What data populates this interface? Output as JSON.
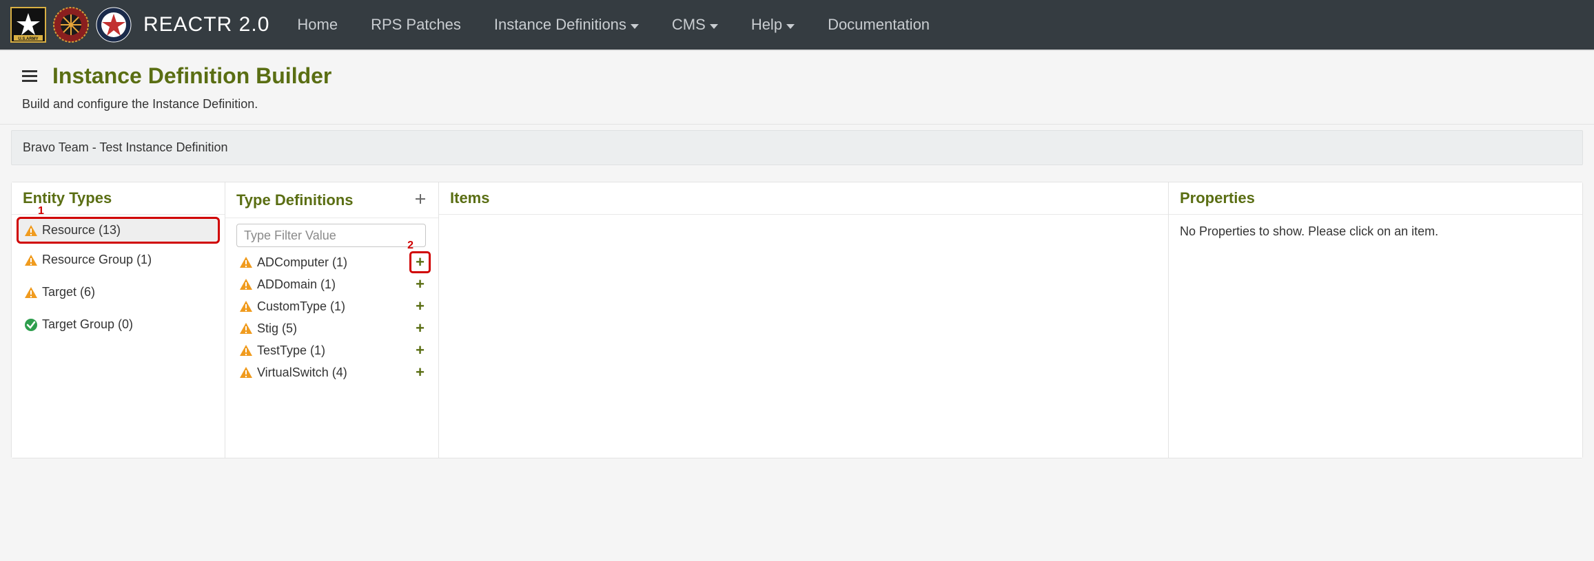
{
  "brand": "REACTR 2.0",
  "nav": {
    "home": "Home",
    "rps": "RPS Patches",
    "instdef": "Instance Definitions",
    "cms": "CMS",
    "help": "Help",
    "docs": "Documentation"
  },
  "page": {
    "title": "Instance Definition Builder",
    "subtitle": "Build and configure the Instance Definition.",
    "breadcrumb": "Bravo Team - Test Instance Definition"
  },
  "markers": {
    "one": "1",
    "two": "2"
  },
  "columns": {
    "entity_heading": "Entity Types",
    "types_heading": "Type Definitions",
    "items_heading": "Items",
    "props_heading": "Properties"
  },
  "entity_types": [
    {
      "label": "Resource (13)",
      "status": "warn",
      "selected": true
    },
    {
      "label": "Resource Group (1)",
      "status": "warn",
      "selected": false
    },
    {
      "label": "Target (6)",
      "status": "warn",
      "selected": false
    },
    {
      "label": "Target Group (0)",
      "status": "ok",
      "selected": false
    }
  ],
  "type_filter_placeholder": "Type Filter Value",
  "type_definitions": [
    {
      "label": "ADComputer (1)",
      "status": "warn",
      "highlight_plus": true
    },
    {
      "label": "ADDomain (1)",
      "status": "warn",
      "highlight_plus": false
    },
    {
      "label": "CustomType (1)",
      "status": "warn",
      "highlight_plus": false
    },
    {
      "label": "Stig (5)",
      "status": "warn",
      "highlight_plus": false
    },
    {
      "label": "TestType (1)",
      "status": "warn",
      "highlight_plus": false
    },
    {
      "label": "VirtualSwitch (4)",
      "status": "warn",
      "highlight_plus": false
    }
  ],
  "properties_empty": "No Properties to show. Please click on an item."
}
